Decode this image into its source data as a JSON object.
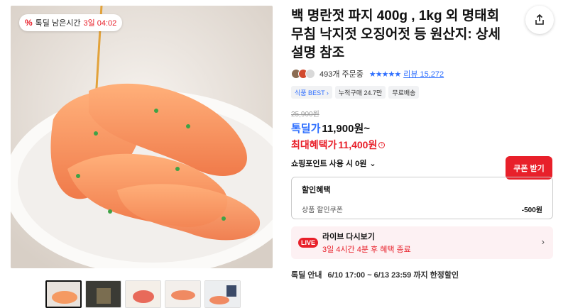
{
  "badge": {
    "pct": "%",
    "label": "톡딜 남은시간",
    "time": "3일 04:02"
  },
  "product": {
    "title": "백 명란젓 파지 400g , 1kg 외 명태회무침 낙지젓 오징어젓 등 원산지: 상세설명 참조",
    "orders": "493개 주문중",
    "stars": "★★★★★",
    "review": "리뷰 15,272",
    "chips": [
      "식품 BEST ›",
      "누적구매 24.7만",
      "무료배송"
    ]
  },
  "price": {
    "original": "25,900원",
    "deal_label": "톡딜가",
    "deal_value": "11,900원~",
    "max_label": "최대혜택가",
    "max_value": "11,400원",
    "info": "i",
    "coupon_button": "쿠폰 받기",
    "points": "쇼핑포인트 사용 시 0원",
    "points_chevron": "⌄"
  },
  "benefit": {
    "heading": "할인혜택",
    "row_label": "상품 할인쿠폰",
    "row_amount": "-500원"
  },
  "live": {
    "badge": "LIVE",
    "title": "라이브 다시보기",
    "subtitle": "3일 4시간 4분 후 혜택 종료",
    "chevron": "›"
  },
  "deal_info": {
    "label": "톡딜 안내",
    "text": "6/10 17:00 ~ 6/13 23:59 까지 한정할인"
  },
  "icons": {
    "share": "share-icon"
  }
}
